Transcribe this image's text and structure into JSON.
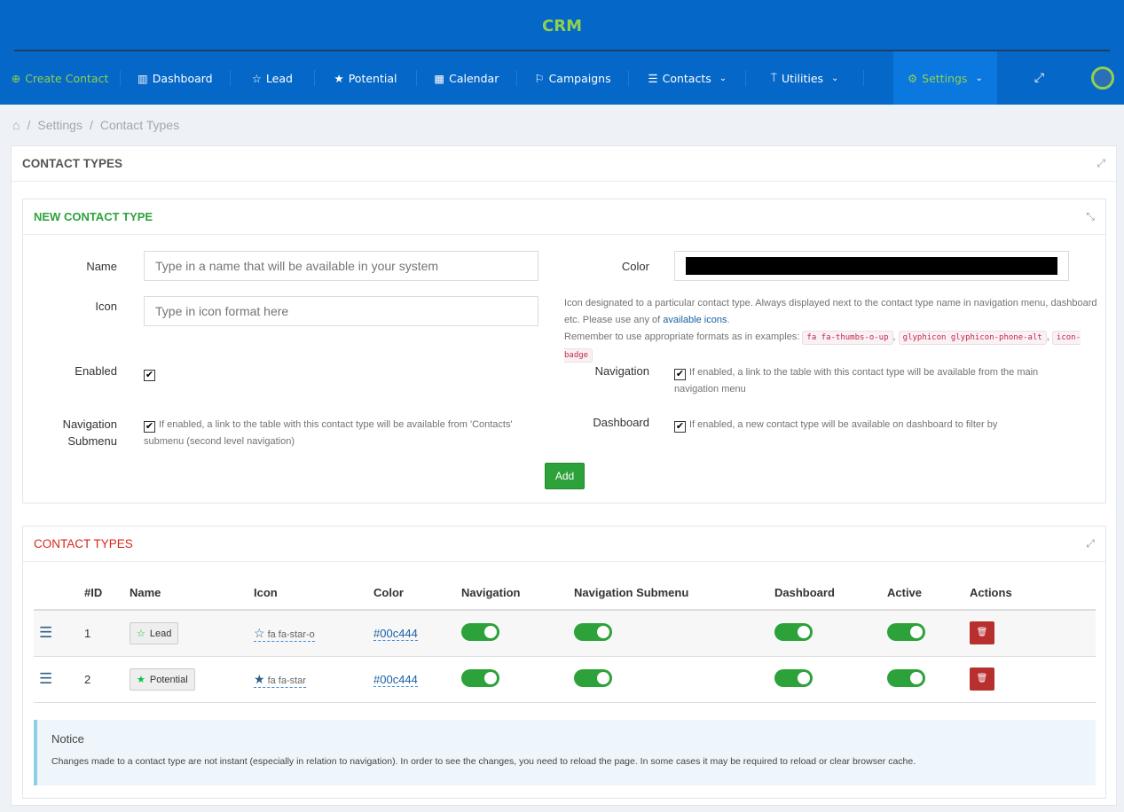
{
  "app": {
    "title": "CRM"
  },
  "nav": {
    "items": [
      {
        "label": "Create Contact",
        "icon": "plus-circle-icon"
      },
      {
        "label": "Dashboard",
        "icon": "bar-chart-icon"
      },
      {
        "label": "Lead",
        "icon": "star-outline-icon"
      },
      {
        "label": "Potential",
        "icon": "star-icon"
      },
      {
        "label": "Calendar",
        "icon": "calendar-icon"
      },
      {
        "label": "Campaigns",
        "icon": "flag-icon"
      },
      {
        "label": "Contacts",
        "icon": "list-icon",
        "dropdown": true
      },
      {
        "label": "Utilities",
        "icon": "signpost-icon",
        "dropdown": true
      },
      {
        "label": "Settings",
        "icon": "gear-icon",
        "dropdown": true,
        "active": true
      }
    ]
  },
  "breadcrumb": {
    "items": [
      "Settings",
      "Contact Types"
    ]
  },
  "main": {
    "title": "CONTACT TYPES"
  },
  "form": {
    "title": "NEW CONTACT TYPE",
    "name_label": "Name",
    "name_placeholder": "Type in a name that will be available in your system",
    "name_value": "",
    "icon_label": "Icon",
    "icon_placeholder": "Type in icon format here",
    "icon_value": "",
    "color_label": "Color",
    "color_value": "#000000",
    "icon_help_1": "Icon designated to a particular contact type. Always displayed next to the contact type name in navigation menu, dashboard etc. Please use any of ",
    "icon_help_link": "available icons",
    "icon_help_2": ".",
    "icon_help_3": "Remember to use appropriate formats as in examples:",
    "examples": [
      "fa fa-thumbs-o-up",
      "glyphicon glyphicon-phone-alt",
      "icon-badge"
    ],
    "enabled_label": "Enabled",
    "enabled": true,
    "navigation_label": "Navigation",
    "navigation": true,
    "navigation_help": "If enabled, a link to the table with this contact type will be available from the main navigation menu",
    "nav_submenu_label_1": "Navigation",
    "nav_submenu_label_2": "Submenu",
    "nav_submenu": true,
    "nav_submenu_help": "If enabled, a link to the table with this contact type will be available from 'Contacts' submenu (second level navigation)",
    "dashboard_label": "Dashboard",
    "dashboard": true,
    "dashboard_help": "If enabled, a new contact type will be available on dashboard to filter by",
    "add_label": "Add"
  },
  "types": {
    "title": "CONTACT TYPES",
    "columns": [
      "#ID",
      "Name",
      "Icon",
      "Color",
      "Navigation",
      "Navigation Submenu",
      "Dashboard",
      "Active",
      "Actions"
    ],
    "rows": [
      {
        "id": "1",
        "name": "Lead",
        "icon": "fa fa-star-o",
        "color": "#00c444",
        "navigation": true,
        "submenu": true,
        "dashboard": true,
        "active": true
      },
      {
        "id": "2",
        "name": "Potential",
        "icon": "fa fa-star",
        "color": "#00c444",
        "navigation": true,
        "submenu": true,
        "dashboard": true,
        "active": true
      }
    ]
  },
  "notice": {
    "title": "Notice",
    "text": "Changes made to a contact type are not instant (especially in relation to navigation). In order to see the changes, you need to reload the page. In some cases it may be required to reload or clear browser cache."
  },
  "colors": {
    "brand": "#0567c7",
    "accent": "#8fd14f",
    "success": "#2da23a",
    "danger": "#b7302e",
    "title_red": "#d9261c",
    "title_green": "#2da23a"
  }
}
